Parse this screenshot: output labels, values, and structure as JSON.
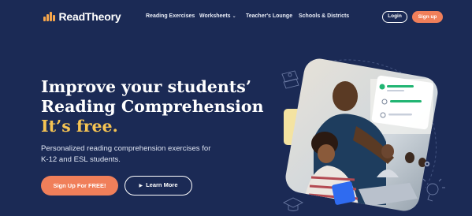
{
  "brand": {
    "name": "ReadTheory",
    "accent": "#f6a64b"
  },
  "nav": {
    "items": [
      "Reading Exercises",
      "Worksheets",
      "Teacher's Lounge",
      "Schools & Districts"
    ],
    "worksheets_icon": "chevron-down-icon",
    "login_label": "Login",
    "signup_label": "Sign up"
  },
  "hero": {
    "title_line1": "Improve your students’",
    "title_line2": "Reading Comprehension",
    "title_line3": "It’s free.",
    "subtitle_line1": "Personalized reading comprehension exercises for",
    "subtitle_line2": "K-12 and ESL students.",
    "cta_primary": "Sign Up For FREE!",
    "cta_secondary": "Learn More",
    "cta_secondary_icon": "play-icon"
  },
  "colors": {
    "background": "#1b2a55",
    "cta": "#f07f5a",
    "highlight": "#f6c453",
    "card_blue": "#2f6bf0",
    "card_yellow": "#f4e3a1"
  }
}
